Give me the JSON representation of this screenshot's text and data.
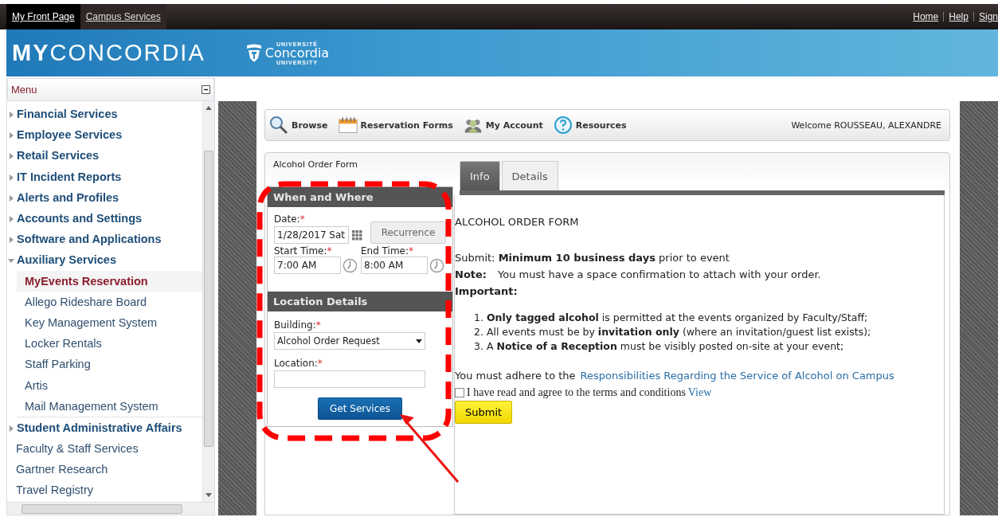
{
  "top_bar": {
    "tabs": [
      {
        "label": "My Front Page",
        "selected": true
      },
      {
        "label": "Campus Services",
        "selected": false
      }
    ],
    "links": [
      "Home",
      "Help",
      "Sign"
    ]
  },
  "banner": {
    "logo_bold": "MY",
    "logo_light": "CONCORDIA",
    "university_top": "UNIVERSITÉ",
    "university_name": "Concordia",
    "university_bottom": "UNIVERSITY"
  },
  "menu": {
    "title": "Menu",
    "items": [
      {
        "kind": "section",
        "label": "Financial Services",
        "expanded": false
      },
      {
        "kind": "section",
        "label": "Employee Services",
        "expanded": false
      },
      {
        "kind": "section",
        "label": "Retail Services",
        "expanded": false
      },
      {
        "kind": "section",
        "label": "IT Incident Reports",
        "expanded": false
      },
      {
        "kind": "section",
        "label": "Alerts and Profiles",
        "expanded": false
      },
      {
        "kind": "section",
        "label": "Accounts and Settings",
        "expanded": false
      },
      {
        "kind": "section",
        "label": "Software and Applications",
        "expanded": false
      },
      {
        "kind": "section",
        "label": "Auxiliary Services",
        "expanded": true,
        "children": [
          {
            "label": "MyEvents Reservation",
            "selected": true
          },
          {
            "label": "Allego Rideshare Board",
            "selected": false
          },
          {
            "label": "Key Management System",
            "selected": false
          },
          {
            "label": "Locker Rentals",
            "selected": false
          },
          {
            "label": "Staff Parking",
            "selected": false
          },
          {
            "label": "Artis",
            "selected": false
          },
          {
            "label": "Mail Management System",
            "selected": false
          }
        ]
      },
      {
        "kind": "section",
        "label": "Student Administrative Affairs",
        "expanded": false
      },
      {
        "kind": "link",
        "label": "Faculty & Staff Services"
      },
      {
        "kind": "link",
        "label": "Gartner Research"
      },
      {
        "kind": "link",
        "label": "Travel Registry"
      }
    ]
  },
  "toolbar": {
    "items": [
      {
        "kind": "search",
        "label": "Browse"
      },
      {
        "kind": "calendar",
        "label": "Reservation Forms"
      },
      {
        "kind": "people",
        "label": "My Account"
      },
      {
        "kind": "help",
        "label": "Resources"
      }
    ],
    "welcome": "Welcome ROUSSEAU, ALEXANDRE"
  },
  "form": {
    "title": "Alcohol Order Form",
    "when_where": {
      "heading": "When and Where",
      "date": {
        "label": "Date:",
        "required_mark": "*",
        "value": "1/28/2017 Sat"
      },
      "recurrence_button": "Recurrence",
      "start_time": {
        "label": "Start Time:",
        "required_mark": "*",
        "value": "7:00 AM"
      },
      "end_time": {
        "label": "End Time:",
        "required_mark": "*",
        "value": "8:00 AM"
      }
    },
    "location_details": {
      "heading": "Location Details",
      "building": {
        "label": "Building:",
        "required_mark": "*",
        "value": "Alcohol Order Request"
      },
      "location": {
        "label": "Location:",
        "required_mark": "*"
      }
    },
    "get_services_button": "Get Services",
    "tabs": [
      {
        "label": "Info",
        "selected": true
      },
      {
        "label": "Details",
        "selected": false
      }
    ],
    "info": {
      "heading": "ALCOHOL ORDER FORM",
      "submit_line": "Submit:  **Minimum 10 business days** prior to event",
      "note_label": "Note:",
      "note_text": "You must have a space confirmation to attach with your order.",
      "important_label": "Important:",
      "rules": [
        "1. **Only tagged alcohol**  is permitted at the events organized by Faculty/Staff;",
        "2. All events must be by **invitation only** (where an invitation/guest list exists);",
        "3. A **Notice of a Reception** must be visibly posted on-site at your event;"
      ],
      "adhere_text": "You must adhere to the",
      "adhere_link": "Responsibilities Regarding the Service of Alcohol on Campus",
      "agree": {
        "checked": false,
        "label": "I have read and agree to the terms and conditions",
        "link": "View"
      },
      "submit_button": "Submit"
    }
  }
}
